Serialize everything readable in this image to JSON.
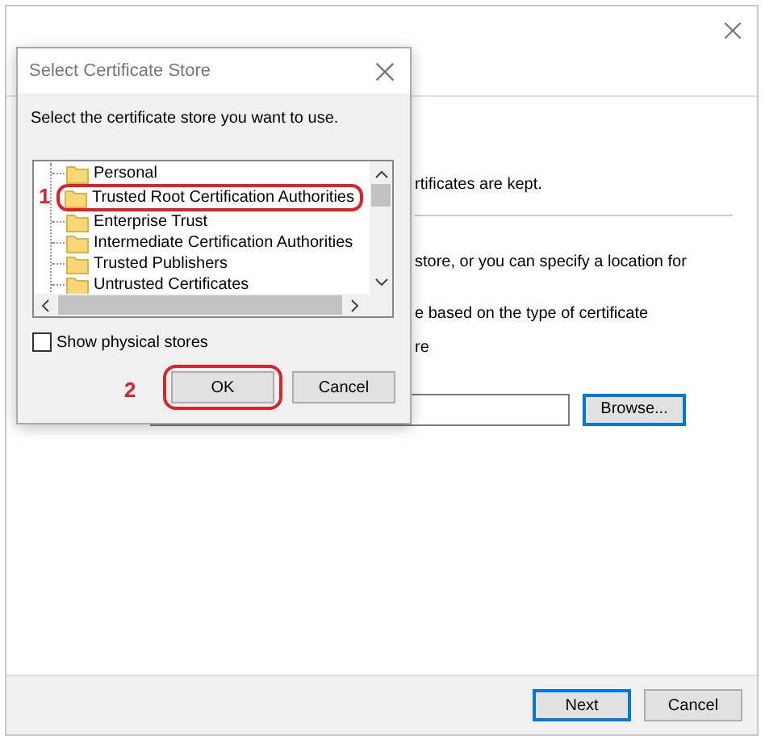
{
  "wizard": {
    "intro_line": "rtificates are kept.",
    "body_lines": [
      "store, or you can specify a location for",
      "e based on the type of certificate",
      "re"
    ],
    "browse_button": {
      "label": "Browse...",
      "default": true
    },
    "footer_buttons": [
      {
        "label": "Next",
        "default": true
      },
      {
        "label": "Cancel",
        "default": false
      }
    ]
  },
  "dialog": {
    "title": "Select Certificate Store",
    "instruction": "Select the certificate store you want to use.",
    "stores": [
      {
        "label": "Personal"
      },
      {
        "label": "Trusted Root Certification Authorities",
        "callout": "1"
      },
      {
        "label": "Enterprise Trust"
      },
      {
        "label": "Intermediate Certification Authorities"
      },
      {
        "label": "Trusted Publishers"
      },
      {
        "label": "Untrusted Certificates"
      }
    ],
    "show_physical_stores": {
      "label": "Show physical stores",
      "checked": false
    },
    "buttons": [
      {
        "label": "OK",
        "callout": "2"
      },
      {
        "label": "Cancel"
      }
    ]
  }
}
